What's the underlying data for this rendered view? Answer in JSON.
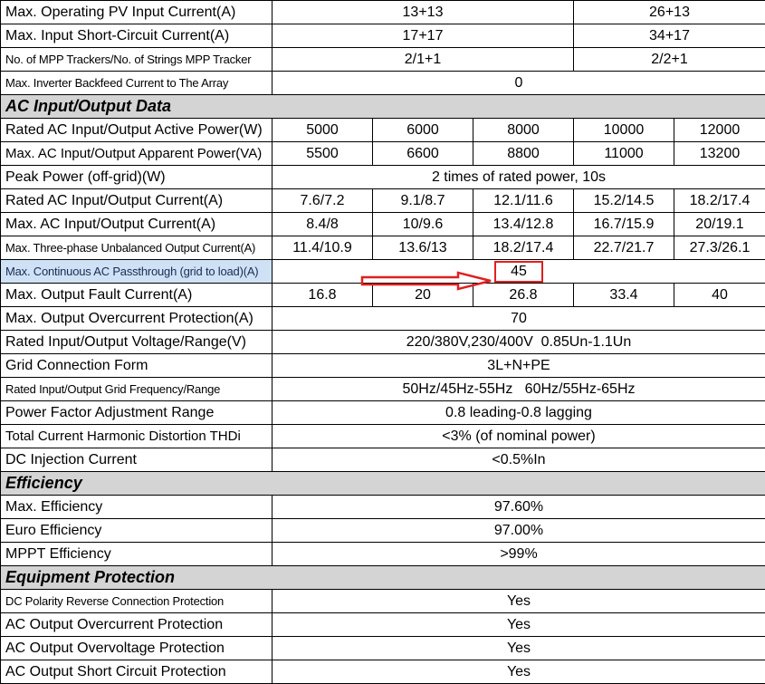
{
  "rows": [
    {
      "label": "Max. Operating PV Input Current(A)",
      "left": "13+13",
      "right": "26+13"
    },
    {
      "label": "Max. Input Short-Circuit Current(A)",
      "left": "17+17",
      "right": "34+17"
    },
    {
      "label": "No. of MPP Trackers/No. of Strings MPP Tracker",
      "left": "2/1+1",
      "right": "2/2+1"
    },
    {
      "label": "Max. Inverter Backfeed Current to The Array",
      "span": "0"
    }
  ],
  "sections": {
    "ac": "AC Input/Output Data",
    "efficiency": "Efficiency",
    "protection": "Equipment Protection"
  },
  "ac_rows": [
    {
      "label": "Rated AC Input/Output Active Power(W)",
      "values": [
        "5000",
        "6000",
        "8000",
        "10000",
        "12000"
      ]
    },
    {
      "label": "Max. AC Input/Output Apparent Power(VA)",
      "values": [
        "5500",
        "6600",
        "8800",
        "11000",
        "13200"
      ]
    },
    {
      "label": "Peak Power (off-grid)(W)",
      "span": "2 times of rated power, 10s"
    },
    {
      "label": "Rated AC Input/Output Current(A)",
      "values": [
        "7.6/7.2",
        "9.1/8.7",
        "12.1/11.6",
        "15.2/14.5",
        "18.2/17.4"
      ]
    },
    {
      "label": "Max. AC Input/Output Current(A)",
      "values": [
        "8.4/8",
        "10/9.6",
        "13.4/12.8",
        "16.7/15.9",
        "20/19.1"
      ]
    },
    {
      "label": "Max. Three-phase Unbalanced Output Current(A)",
      "values": [
        "11.4/10.9",
        "13.6/13",
        "18.2/17.4",
        "22.7/21.7",
        "27.3/26.1"
      ]
    },
    {
      "label": "Max. Continuous AC Passthrough (grid to load)(A)",
      "span": "45"
    },
    {
      "label": "Max. Output Fault Current(A)",
      "values": [
        "16.8",
        "20",
        "26.8",
        "33.4",
        "40"
      ]
    },
    {
      "label": "Max. Output Overcurrent Protection(A)",
      "span": "70"
    },
    {
      "label": "Rated Input/Output Voltage/Range(V)",
      "span": "220/380V,230/400V  0.85Un-1.1Un"
    },
    {
      "label": "Grid Connection Form",
      "span": "3L+N+PE"
    },
    {
      "label": "Rated Input/Output Grid Frequency/Range",
      "span": "50Hz/45Hz-55Hz   60Hz/55Hz-65Hz"
    },
    {
      "label": "Power Factor Adjustment Range",
      "span": "0.8 leading-0.8 lagging"
    },
    {
      "label": "Total Current Harmonic Distortion THDi",
      "span": "<3% (of nominal power)"
    },
    {
      "label": "DC Injection Current",
      "span": "<0.5%In"
    }
  ],
  "eff_rows": [
    {
      "label": "Max. Efficiency",
      "span": "97.60%"
    },
    {
      "label": "Euro Efficiency",
      "span": "97.00%"
    },
    {
      "label": "MPPT Efficiency",
      "span": ">99%"
    }
  ],
  "prot_rows": [
    {
      "label": "DC Polarity Reverse Connection Protection",
      "span": "Yes"
    },
    {
      "label": "AC Output Overcurrent Protection",
      "span": "Yes"
    },
    {
      "label": "AC Output Overvoltage Protection",
      "span": "Yes"
    },
    {
      "label": "AC Output Short Circuit Protection",
      "span": "Yes"
    }
  ],
  "colors": {
    "highlight": "#cfe2f5",
    "annotation": "#e02020",
    "section_bg": "#d4d4d4"
  }
}
